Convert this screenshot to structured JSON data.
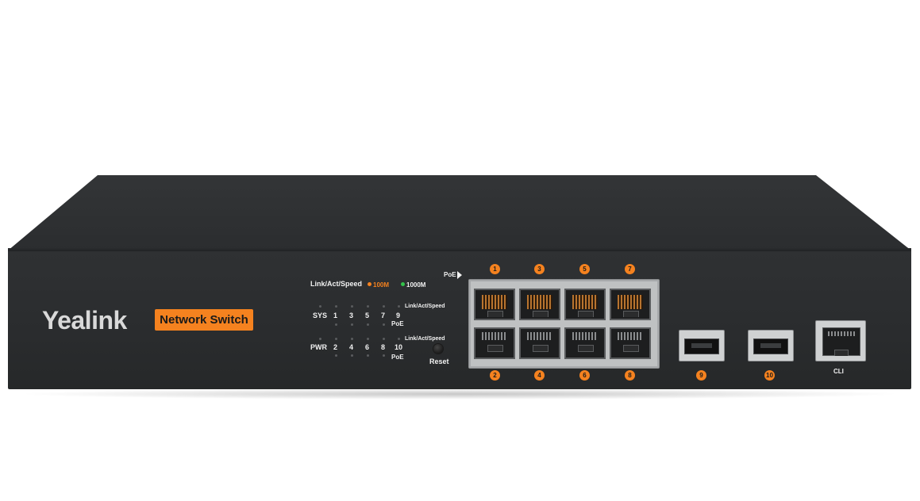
{
  "brand": {
    "name": "Yealink",
    "model_badge": "Network Switch"
  },
  "colors": {
    "accent": "#f5821f",
    "led_100m": "#f5821f",
    "led_1000m": "#33c24a",
    "chassis": "#2c2e30"
  },
  "led_legend": {
    "title": "Link/Act/Speed",
    "speed_low": "100M",
    "speed_high": "1000M"
  },
  "status_labels": {
    "sys": "SYS",
    "pwr": "PWR"
  },
  "led_numbers_top": [
    "1",
    "3",
    "5",
    "7",
    "9"
  ],
  "led_numbers_bottom": [
    "2",
    "4",
    "6",
    "8",
    "10"
  ],
  "led_group_labels": {
    "top_link": "Link/Act/Speed",
    "top_poe": "PoE",
    "bottom_link": "Link/Act/Speed",
    "bottom_poe": "PoE"
  },
  "reset_label": "Reset",
  "poe_marker": "PoE",
  "ports": {
    "top_numbers": [
      "1",
      "3",
      "5",
      "7"
    ],
    "bottom_numbers": [
      "2",
      "4",
      "6",
      "8"
    ],
    "sfp_numbers": [
      "9",
      "10"
    ],
    "console_label": "CLI"
  }
}
